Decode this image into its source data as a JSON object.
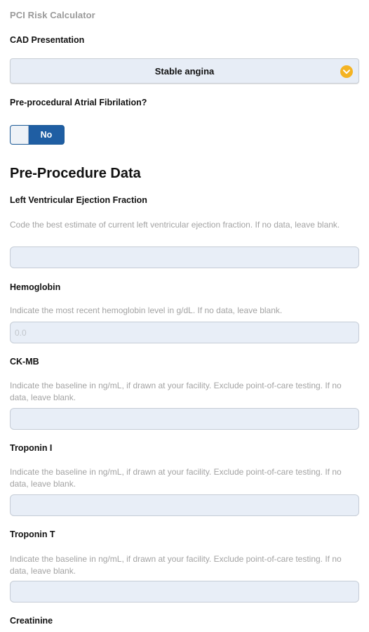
{
  "app": {
    "title": "PCI Risk Calculator"
  },
  "cad": {
    "label": "CAD Presentation",
    "selected": "Stable angina",
    "icon": "chevron-down-icon",
    "icon_color": "#f4b322"
  },
  "afib": {
    "label": "Pre-procedural Atrial Fibrilation?",
    "toggle_text": "No",
    "toggle_color": "#1f5ea3"
  },
  "section": {
    "title": "Pre-Procedure Data"
  },
  "fields": {
    "lvef": {
      "label": "Left Ventricular Ejection Fraction",
      "help": "Code the best estimate of current left ventricular ejection fraction. If no data, leave blank.",
      "value": "",
      "placeholder": ""
    },
    "hemoglobin": {
      "label": "Hemoglobin",
      "help": "Indicate the most recent hemoglobin level in g/dL. If no data, leave blank.",
      "value": "",
      "placeholder": "0.0"
    },
    "ckmb": {
      "label": "CK-MB",
      "help": "Indicate the baseline in ng/mL, if drawn at your facility. Exclude point-of-care testing. If no data, leave blank.",
      "value": "",
      "placeholder": ""
    },
    "troponin_i": {
      "label": "Troponin I",
      "help": "Indicate the baseline in ng/mL, if drawn at your facility. Exclude point-of-care testing. If no data, leave blank.",
      "value": "",
      "placeholder": ""
    },
    "troponin_t": {
      "label": "Troponin T",
      "help": "Indicate the baseline in ng/mL, if drawn at your facility. Exclude point-of-care testing. If no data, leave blank.",
      "value": "",
      "placeholder": ""
    },
    "creatinine": {
      "label": "Creatinine"
    }
  }
}
